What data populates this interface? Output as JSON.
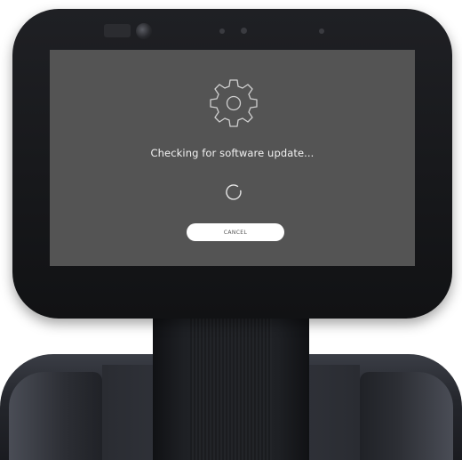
{
  "screen": {
    "status_text": "Checking for software update...",
    "cancel_label": "CANCEL",
    "icon": "gear-icon",
    "loading_icon": "spinner-icon",
    "background_color": "#545454",
    "text_color": "#f2f2f2",
    "button_color": "#ffffff"
  }
}
